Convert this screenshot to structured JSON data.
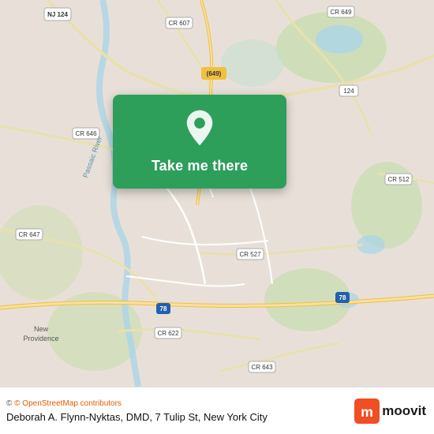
{
  "map": {
    "background_color": "#e8e0d8"
  },
  "location_card": {
    "button_label": "Take me there",
    "pin_color": "#ffffff",
    "card_color": "#2e9e5b"
  },
  "bottom_bar": {
    "attribution": "© OpenStreetMap contributors",
    "place_name": "Deborah A. Flynn-Nyktas, DMD, 7 Tulip St, New York City",
    "moovit_label": "moovit"
  },
  "road_labels": [
    "NJ 124",
    "CR 607",
    "CR 649",
    "CR 646",
    "(649)",
    "124",
    "CR 512",
    "Passaic River",
    "CR 647",
    "CR 527",
    "CR 622",
    "I 78",
    "CR 643",
    "New Providence",
    "I 78"
  ]
}
